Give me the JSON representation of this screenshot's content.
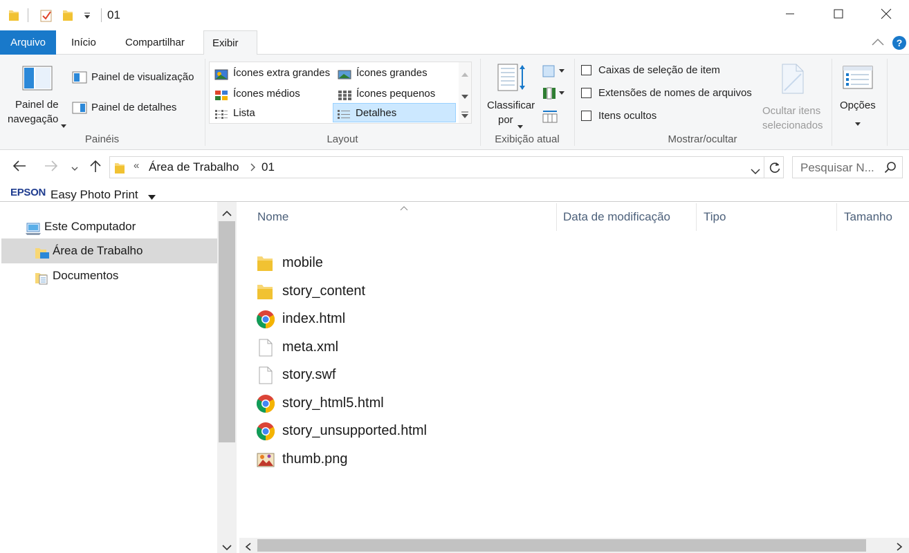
{
  "window": {
    "title": "01",
    "controls": {
      "minimize": "minimize-icon",
      "maximize": "maximize-icon",
      "close": "close-icon"
    }
  },
  "ribbon_tabs": [
    "Arquivo",
    "Início",
    "Compartilhar",
    "Exibir"
  ],
  "active_tab": "Exibir",
  "ribbon": {
    "paineis": {
      "nav_pane_line1": "Painel de",
      "nav_pane_line2": "navegação",
      "preview_pane": "Painel de visualização",
      "details_pane": "Painel de detalhes",
      "label": "Painéis"
    },
    "layout": {
      "items": [
        "Ícones extra grandes",
        "Ícones grandes",
        "Ícones médios",
        "Ícones pequenos",
        "Lista",
        "Detalhes"
      ],
      "selected": "Detalhes",
      "label": "Layout"
    },
    "current_view": {
      "sort_line1": "Classificar",
      "sort_line2": "por",
      "label": "Exibição atual"
    },
    "show_hide": {
      "checkboxes": [
        "Caixas de seleção de item",
        "Extensões de nomes de arquivos",
        "Itens ocultos"
      ],
      "hide_selected_line1": "Ocultar itens",
      "hide_selected_line2": "selecionados",
      "label": "Mostrar/ocultar"
    },
    "options": {
      "label": "Opções"
    }
  },
  "address": {
    "overflow": "«",
    "crumbs": [
      "Área de Trabalho",
      "01"
    ],
    "search_placeholder": "Pesquisar N..."
  },
  "toolbar": {
    "brand": "EPSON",
    "app": "Easy Photo Print"
  },
  "nav_tree": [
    "Este Computador",
    "Área de Trabalho",
    "Documentos"
  ],
  "nav_selected": "Área de Trabalho",
  "columns": [
    "Nome",
    "Data de modificação",
    "Tipo",
    "Tamanho"
  ],
  "files": [
    {
      "name": "mobile",
      "icon": "folder-icon"
    },
    {
      "name": "story_content",
      "icon": "folder-icon"
    },
    {
      "name": "index.html",
      "icon": "chrome-icon"
    },
    {
      "name": "meta.xml",
      "icon": "file-icon"
    },
    {
      "name": "story.swf",
      "icon": "file-icon"
    },
    {
      "name": "story_html5.html",
      "icon": "chrome-icon"
    },
    {
      "name": "story_unsupported.html",
      "icon": "chrome-icon"
    },
    {
      "name": "thumb.png",
      "icon": "image-icon"
    }
  ],
  "colors": {
    "accent": "#1979ca",
    "selection": "#cce8ff",
    "selection_border": "#99d1ff",
    "nav_selected": "#d9d9d9"
  }
}
